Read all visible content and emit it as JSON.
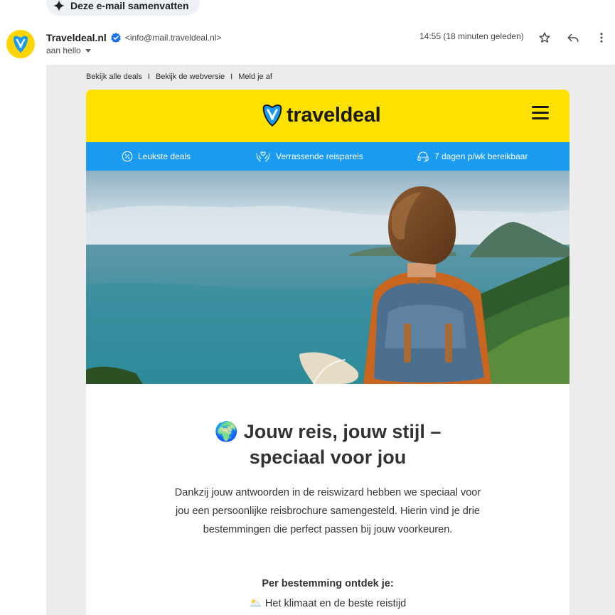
{
  "toolbar": {
    "summarize_label": "Deze e-mail samenvatten"
  },
  "sender": {
    "name": "Traveldeal.nl",
    "email": "<info@mail.traveldeal.nl>",
    "to": "aan hello",
    "timestamp": "14:55 (18 minuten geleden)"
  },
  "email": {
    "preheader": {
      "links": [
        "Bekijk alle deals",
        "Bekijk de webversie",
        "Meld je af"
      ],
      "separator": "I"
    },
    "brand": {
      "logo_text": "traveldeal",
      "color": "#ffe100"
    },
    "usps": [
      {
        "icon": "discount-badge-icon",
        "label": "Leukste deals"
      },
      {
        "icon": "hands-heart-icon",
        "label": "Verrassende reisparels"
      },
      {
        "icon": "headset-icon",
        "label": "7 dagen p/wk bereikbaar"
      }
    ],
    "usp_color": "#1a9bef",
    "headline_emoji": "🌍",
    "headline_line1": "Jouw reis, jouw stijl –",
    "headline_line2": "speciaal voor jou",
    "intro": "Dankzij jouw antwoorden in de reiswizard hebben we speciaal voor jou een persoonlijke reisbrochure samengesteld. Hierin vind je drie bestemmingen die perfect passen bij jouw voorkeuren.",
    "section_title": "Per bestemming ontdek je:",
    "bullets": [
      {
        "emoji": "🌥️",
        "text": "Het klimaat en de beste reistijd"
      }
    ]
  }
}
